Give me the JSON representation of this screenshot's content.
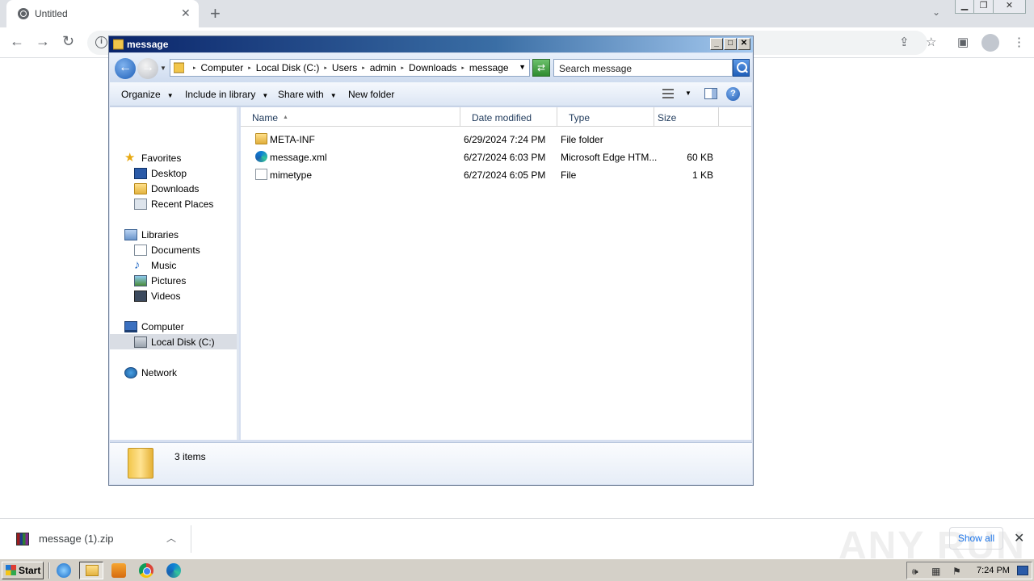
{
  "browser": {
    "tab_title": "Untitled",
    "new_tab": "+",
    "tab_close": "✕"
  },
  "explorer": {
    "title": "message",
    "breadcrumbs": [
      "Computer",
      "Local Disk (C:)",
      "Users",
      "admin",
      "Downloads",
      "message"
    ],
    "search_placeholder": "Search message",
    "commands": {
      "organize": "Organize",
      "include_in_library": "Include in library",
      "share_with": "Share with",
      "new_folder": "New folder"
    },
    "nav": {
      "favorites": "Favorites",
      "desktop": "Desktop",
      "downloads": "Downloads",
      "recent_places": "Recent Places",
      "libraries": "Libraries",
      "documents": "Documents",
      "music": "Music",
      "pictures": "Pictures",
      "videos": "Videos",
      "computer": "Computer",
      "local_disk": "Local Disk (C:)",
      "network": "Network"
    },
    "columns": {
      "name": "Name",
      "date_modified": "Date modified",
      "type": "Type",
      "size": "Size"
    },
    "files": [
      {
        "name": "META-INF",
        "date": "6/29/2024 7:24 PM",
        "type": "File folder",
        "size": "",
        "icon": "folder-icon"
      },
      {
        "name": "message.xml",
        "date": "6/27/2024 6:03 PM",
        "type": "Microsoft Edge HTM...",
        "size": "60 KB",
        "icon": "edge-icon"
      },
      {
        "name": "mimetype",
        "date": "6/27/2024 6:05 PM",
        "type": "File",
        "size": "1 KB",
        "icon": "file-icon"
      }
    ],
    "item_count": "3 items"
  },
  "download_bar": {
    "filename": "message (1).zip",
    "show_all": "Show all",
    "watermark": "ANY RUN"
  },
  "taskbar": {
    "start": "Start",
    "clock": "7:24 PM"
  }
}
